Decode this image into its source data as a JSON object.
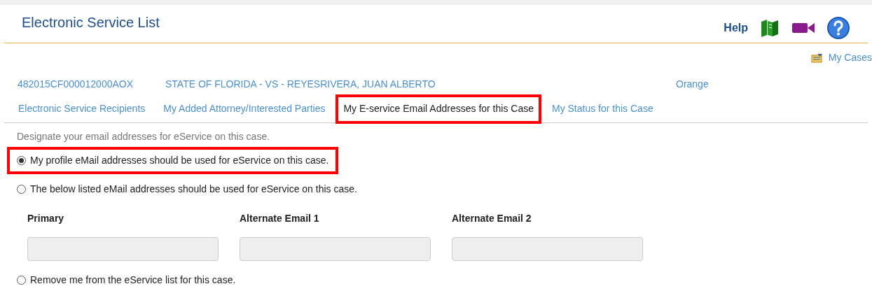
{
  "header": {
    "title": "Electronic Service List",
    "help_label": "Help"
  },
  "my_cases_link": "My Cases",
  "case": {
    "number": "482015CF000012000AOX",
    "title": "STATE OF FLORIDA - VS - REYESRIVERA, JUAN ALBERTO",
    "county": "Orange"
  },
  "tabs": [
    {
      "label": "Electronic Service Recipients",
      "selected": false,
      "highlighted": false
    },
    {
      "label": "My Added Attorney/Interested Parties",
      "selected": false,
      "highlighted": false
    },
    {
      "label": "My E-service Email Addresses for this Case",
      "selected": true,
      "highlighted": true
    },
    {
      "label": "My Status for this Case",
      "selected": false,
      "highlighted": false
    }
  ],
  "instructions": "Designate your email addresses for eService on this case.",
  "options": [
    {
      "kind": "radio",
      "label": "My profile eMail addresses should be used for eService on this case.",
      "selected": true,
      "highlighted": true
    },
    {
      "kind": "radio",
      "label": "The below listed eMail addresses should be used for eService on this case.",
      "selected": false,
      "highlighted": false
    },
    {
      "kind": "fields",
      "fields": [
        {
          "label": "Primary",
          "disabled": true
        },
        {
          "label": "Alternate Email 1",
          "disabled": true
        },
        {
          "label": "Alternate Email 2",
          "disabled": true
        }
      ]
    },
    {
      "kind": "radio",
      "label": "Remove me from the eService list for this case.",
      "selected": false,
      "highlighted": false
    }
  ]
}
